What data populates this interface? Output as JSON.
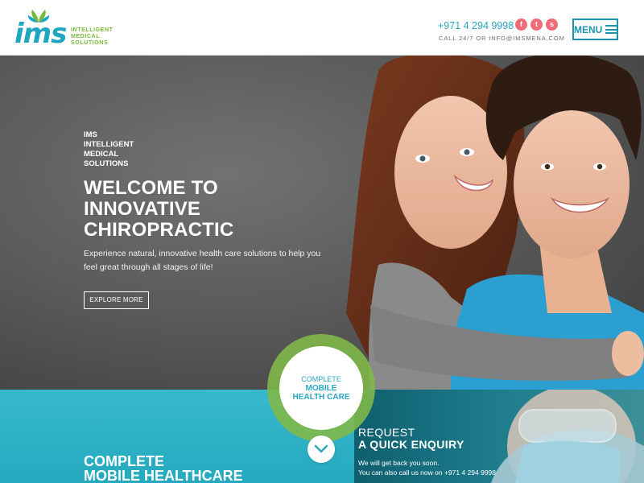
{
  "brand": {
    "logo_text": "ims",
    "sub_lines": [
      "INTELLIGENT",
      "MEDICAL",
      "SOLUTIONS"
    ],
    "accent": "#1fa6c0",
    "green": "#79b83a"
  },
  "header": {
    "phone": "+971 4 294 9998",
    "contact_line": "CALL 24/7 OR  INFO@IMSMENA.COM",
    "social": [
      {
        "icon": "facebook-icon",
        "glyph": "f"
      },
      {
        "icon": "twitter-icon",
        "glyph": "t"
      },
      {
        "icon": "skype-icon",
        "glyph": "s"
      }
    ],
    "menu_label": "MENU"
  },
  "hero": {
    "tagline": [
      "IMS",
      "INTELLIGENT",
      "MEDICAL",
      "SOLUTIONS"
    ],
    "title": [
      "WELCOME TO",
      "INNOVATIVE",
      "CHIROPRACTIC"
    ],
    "description": "Experience natural, innovative health care solutions to help you feel great through all stages of life!",
    "cta": "EXPLORE MORE"
  },
  "badge": {
    "line1": "COMPLETE",
    "line2": "MOBILE",
    "line3": "HEALTH CARE"
  },
  "bottom": {
    "section_title": [
      "COMPLETE",
      "MOBILE HEALTHCARE"
    ],
    "request_line1": "REQUEST",
    "request_line2": "A QUICK ENQUIRY",
    "message": [
      "We will get back you soon.",
      "You can also call us now on +971 4 294 9998"
    ]
  },
  "colors": {
    "teal": "#25a9bf",
    "coral": "#ef6c77",
    "lime": "#7fb84a"
  }
}
